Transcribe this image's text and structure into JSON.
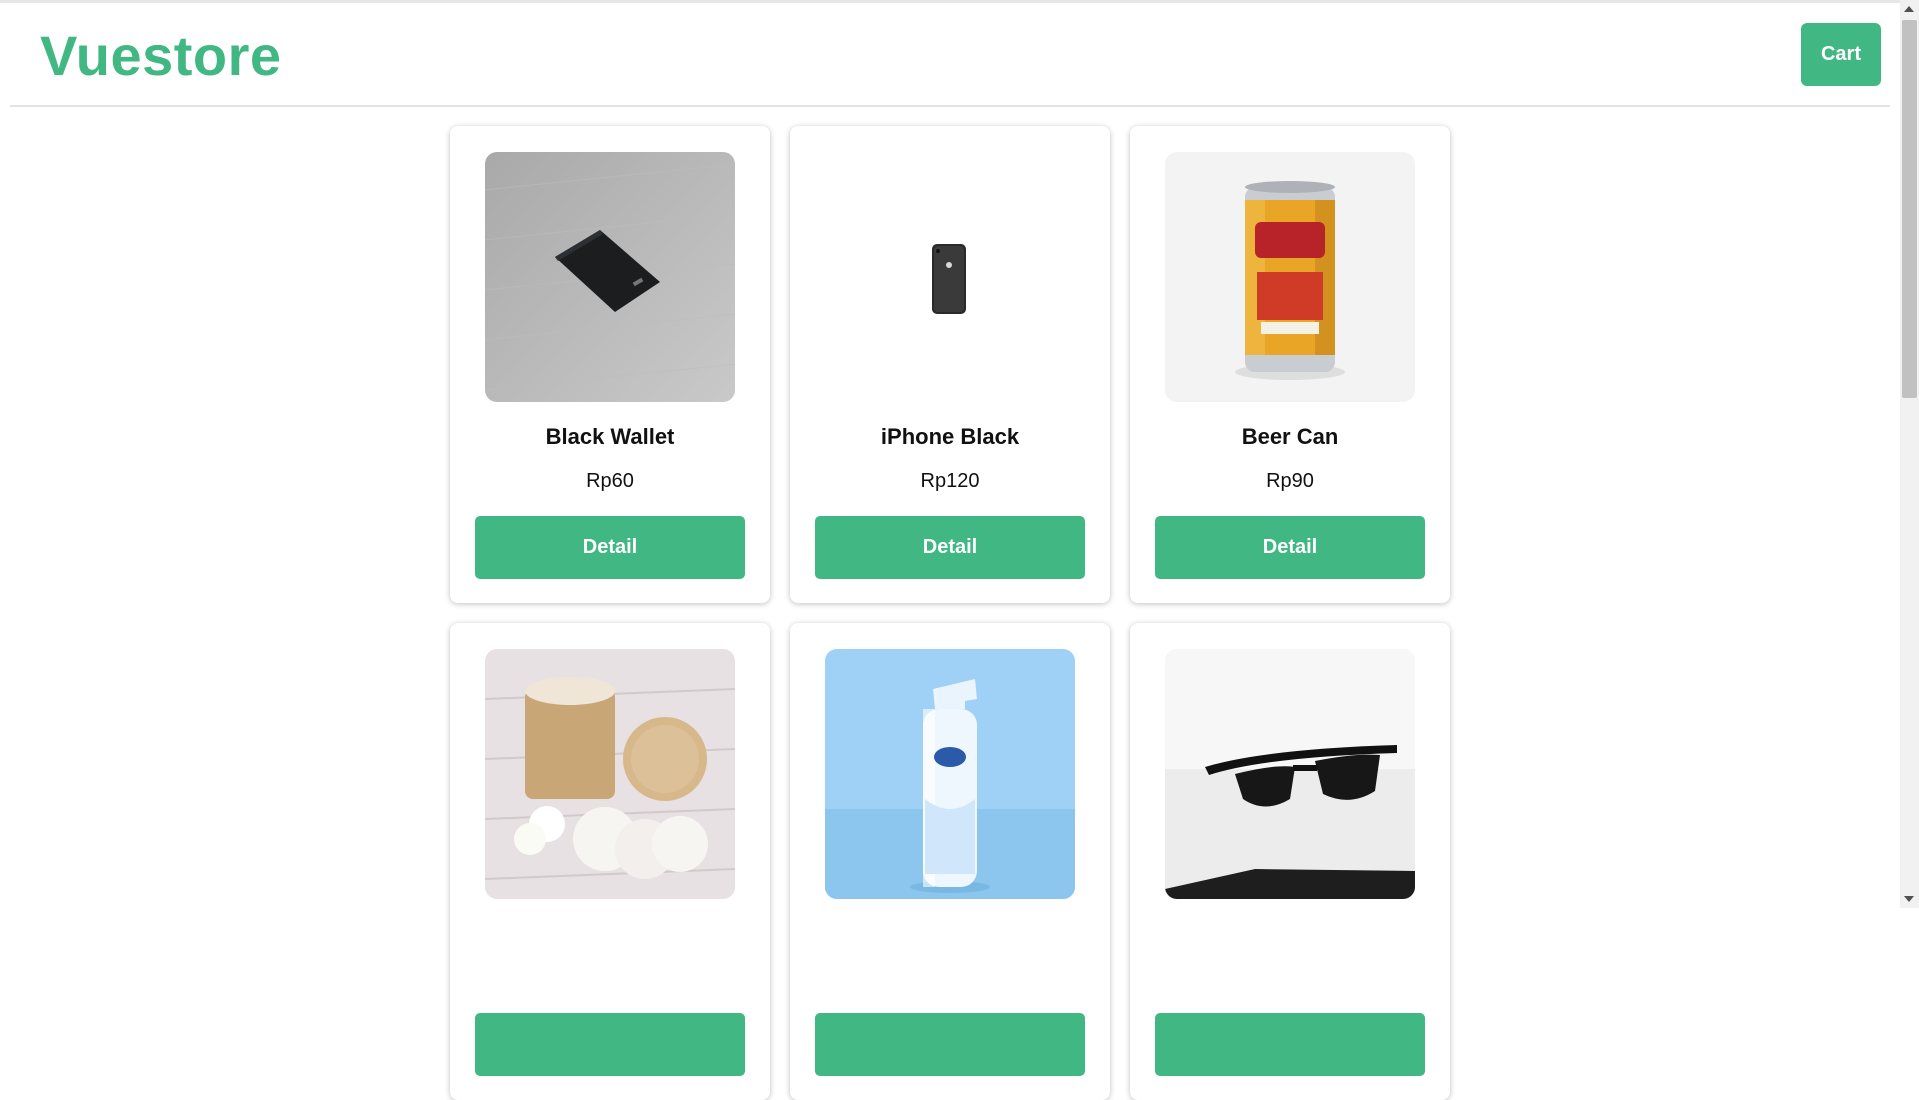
{
  "header": {
    "brand": "Vuestore",
    "cart_label": "Cart"
  },
  "colors": {
    "accent": "#41b883",
    "text": "#111111"
  },
  "products": [
    {
      "name": "Black Wallet",
      "price": "Rp60",
      "detail_label": "Detail",
      "image": "black-wallet-photo"
    },
    {
      "name": "iPhone Black",
      "price": "Rp120",
      "detail_label": "Detail",
      "image": "iphone-black-photo"
    },
    {
      "name": "Beer Can",
      "price": "Rp90",
      "detail_label": "Detail",
      "image": "ginger-beer-can-photo"
    },
    {
      "name": "",
      "price": "",
      "detail_label": "",
      "image": "cotton-pads-jar-photo"
    },
    {
      "name": "",
      "price": "",
      "detail_label": "",
      "image": "air-freshener-photo"
    },
    {
      "name": "",
      "price": "",
      "detail_label": "",
      "image": "sunglasses-photo"
    }
  ]
}
